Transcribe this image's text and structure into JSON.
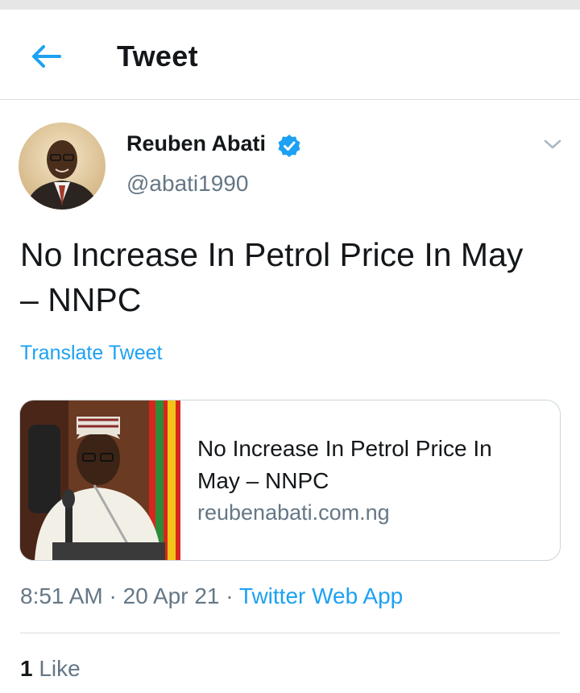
{
  "header": {
    "title": "Tweet",
    "back_icon": "arrow-left-icon",
    "accent_color": "#1da1f2"
  },
  "tweet": {
    "author": {
      "display_name": "Reuben Abati",
      "handle": "@abati1990",
      "verified": true,
      "verified_icon": "verified-badge-icon",
      "menu_icon": "chevron-down-icon"
    },
    "text_line1": "No Increase In Petrol Price In May",
    "text_line2": "– NNPC",
    "translate_label": "Translate Tweet",
    "link_card": {
      "title_line1": "No Increase In Petrol Price In",
      "title_line2": "May – NNPC",
      "domain": "reubenabati.com.ng"
    },
    "meta": {
      "time": "8:51 AM",
      "sep1": " · ",
      "date": "20 Apr 21",
      "sep2": " · ",
      "source": "Twitter Web App"
    },
    "likes": {
      "count": "1",
      "label": "Like"
    }
  },
  "colors": {
    "text_primary": "#14171a",
    "text_secondary": "#657786",
    "link": "#1da1f2",
    "border": "#ccd6dd"
  }
}
